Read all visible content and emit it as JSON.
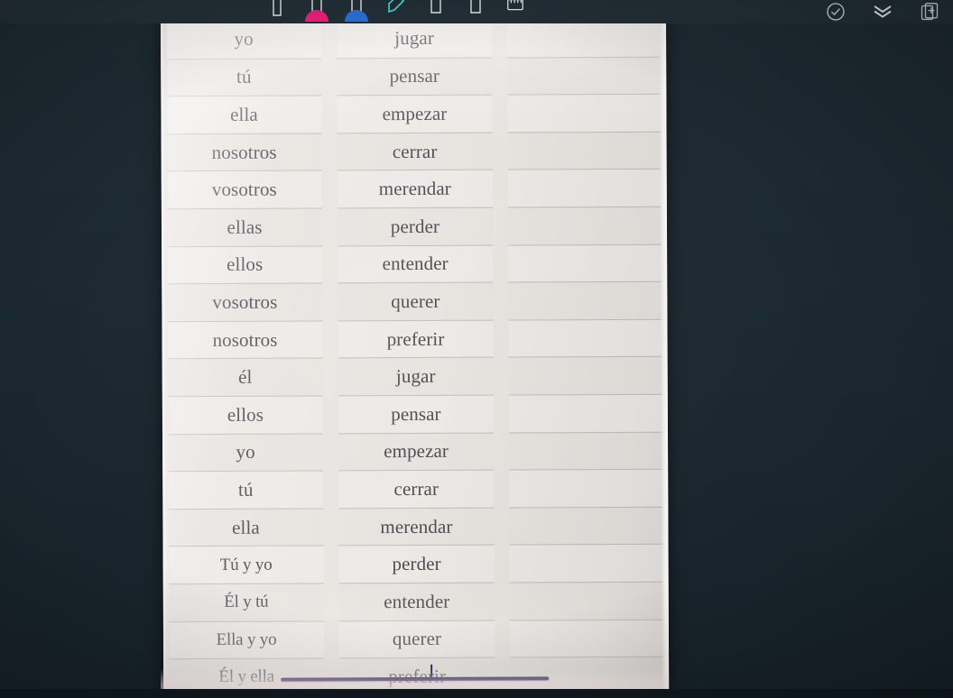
{
  "app": {
    "background_color": "#1b2830",
    "paper_color": "#e7e5e0",
    "rule_color": "#c0bdba",
    "text_color": "#4e4a52",
    "annotation_color": "#3a3066"
  },
  "toolbar": {
    "left_tools": [
      {
        "name": "pen-tool",
        "label": "Pen",
        "chip_color": null
      },
      {
        "name": "highlighter-pink-tool",
        "label": "Highlighter Pink",
        "chip_color": "#ec1e79"
      },
      {
        "name": "highlighter-blue-tool",
        "label": "Highlighter Blue",
        "chip_color": "#2a6ed8"
      },
      {
        "name": "eraser-tool",
        "label": "Eraser",
        "chip_color": null
      },
      {
        "name": "pencil-tool",
        "label": "Pencil",
        "chip_color": null
      },
      {
        "name": "marker-tool",
        "label": "Marker",
        "chip_color": null
      },
      {
        "name": "ruler-tool",
        "label": "Ruler",
        "chip_color": null
      }
    ],
    "right_tools": [
      {
        "name": "check-circle-icon",
        "label": "Done"
      },
      {
        "name": "chevrons-down-icon",
        "label": "Collapse toolbar"
      },
      {
        "name": "add-page-icon",
        "label": "Add page"
      }
    ]
  },
  "worksheet": {
    "columns": [
      {
        "key": "pronoun",
        "header": ""
      },
      {
        "key": "verb",
        "header": ""
      },
      {
        "key": "answer",
        "header": ""
      }
    ],
    "rows": [
      {
        "pronoun": "yo",
        "verb": "jugar",
        "answer": ""
      },
      {
        "pronoun": "tú",
        "verb": "pensar",
        "answer": ""
      },
      {
        "pronoun": "ella",
        "verb": "empezar",
        "answer": ""
      },
      {
        "pronoun": "nosotros",
        "verb": "cerrar",
        "answer": ""
      },
      {
        "pronoun": "vosotros",
        "verb": "merendar",
        "answer": ""
      },
      {
        "pronoun": "ellas",
        "verb": "perder",
        "answer": ""
      },
      {
        "pronoun": "ellos",
        "verb": "entender",
        "answer": ""
      },
      {
        "pronoun": "vosotros",
        "verb": "querer",
        "answer": ""
      },
      {
        "pronoun": "nosotros",
        "verb": "preferir",
        "answer": ""
      },
      {
        "pronoun": "él",
        "verb": "jugar",
        "answer": ""
      },
      {
        "pronoun": "ellos",
        "verb": "pensar",
        "answer": ""
      },
      {
        "pronoun": "yo",
        "verb": "empezar",
        "answer": ""
      },
      {
        "pronoun": "tú",
        "verb": "cerrar",
        "answer": ""
      },
      {
        "pronoun": "ella",
        "verb": "merendar",
        "answer": ""
      },
      {
        "pronoun": "Tú y yo",
        "verb": "perder",
        "answer": "",
        "phrase": true
      },
      {
        "pronoun": "Él y tú",
        "verb": "entender",
        "answer": "",
        "phrase": true
      },
      {
        "pronoun": "Ella y yo",
        "verb": "querer",
        "answer": "",
        "phrase": true
      },
      {
        "pronoun": "Él y ella",
        "verb": "preferir",
        "answer": "",
        "phrase": true
      }
    ]
  },
  "annotations": [
    {
      "name": "underline-stroke",
      "type": "ink-line",
      "color": "#3a3066"
    }
  ]
}
